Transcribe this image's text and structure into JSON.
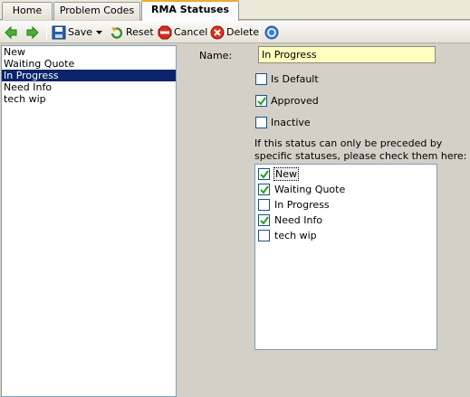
{
  "tabs": [
    {
      "label": "Home"
    },
    {
      "label": "Problem Codes"
    },
    {
      "label": "RMA Statuses"
    }
  ],
  "toolbar": {
    "save_label": "Save",
    "reset_label": "Reset",
    "cancel_label": "Cancel",
    "delete_label": "Delete"
  },
  "statuses": [
    {
      "label": "New"
    },
    {
      "label": "Waiting Quote"
    },
    {
      "label": "In Progress"
    },
    {
      "label": "Need Info"
    },
    {
      "label": "tech wip"
    }
  ],
  "selected_index": 2,
  "form": {
    "name_label": "Name:",
    "name_value": "In Progress",
    "is_default_label": "Is Default",
    "is_default_checked": false,
    "approved_label": "Approved",
    "approved_checked": true,
    "inactive_label": "Inactive",
    "inactive_checked": false,
    "preceded_text_1": "If this status can only be preceded by",
    "preceded_text_2": "specific statuses, please check them here:",
    "preceded": [
      {
        "label": "New",
        "checked": true
      },
      {
        "label": "Waiting Quote",
        "checked": true
      },
      {
        "label": "In Progress",
        "checked": false
      },
      {
        "label": "Need Info",
        "checked": true
      },
      {
        "label": "tech wip",
        "checked": false
      }
    ]
  },
  "colors": {
    "selection": "#0a246a",
    "name_field_bg": "#ffffc0",
    "panel_bg": "#d4d0c8"
  }
}
